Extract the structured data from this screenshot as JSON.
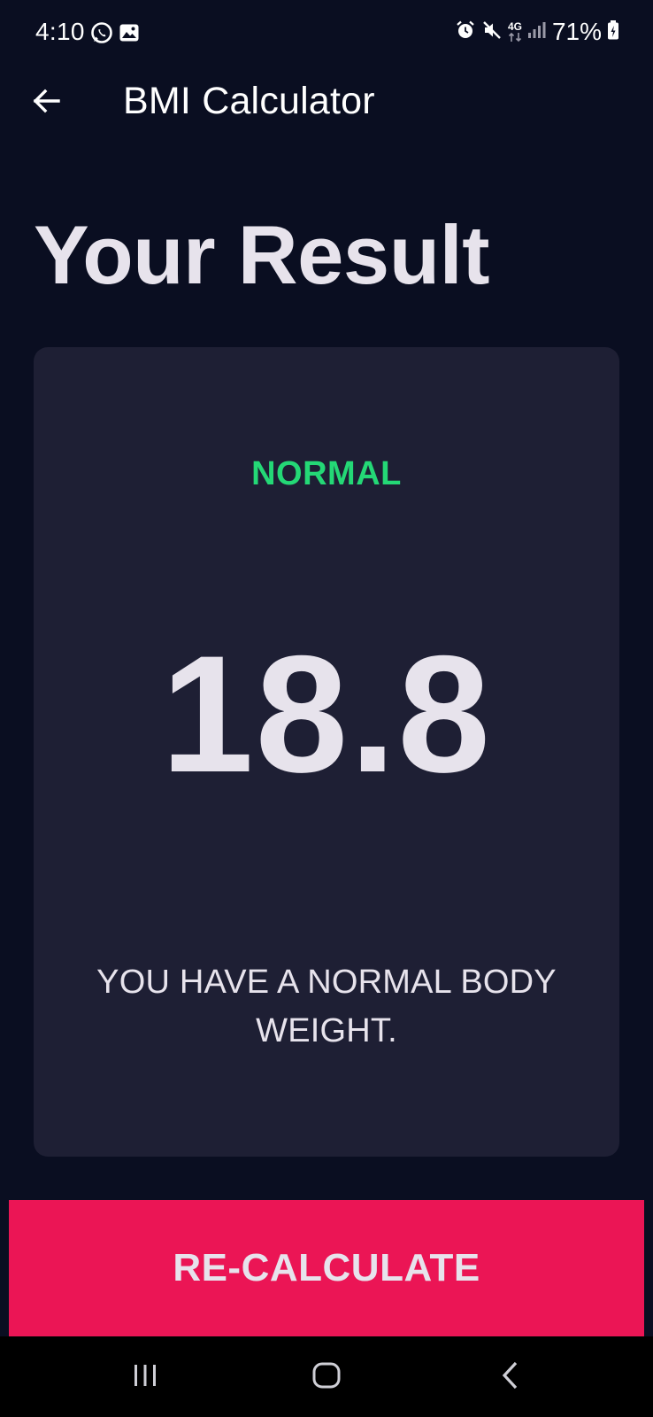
{
  "status_bar": {
    "time": "4:10",
    "left_icons": [
      "whatsapp-icon",
      "image-icon"
    ],
    "right_icons": [
      "alarm-icon",
      "mute-icon",
      "4g-icon",
      "signal-icon",
      "battery-icon"
    ],
    "network_label": "4G",
    "battery_percent": "71%"
  },
  "app_bar": {
    "back_icon": "arrow-left-icon",
    "title": "BMI Calculator"
  },
  "main": {
    "heading": "Your Result",
    "result": {
      "status": "NORMAL",
      "bmi": "18.8",
      "message": "YOU HAVE A NORMAL BODY WEIGHT."
    },
    "recalculate_label": "RE-CALCULATE"
  },
  "nav_bar": {
    "buttons": [
      "recent-apps-icon",
      "home-icon",
      "back-chevron-icon"
    ]
  },
  "colors": {
    "background": "#0a0e21",
    "card": "#1e1f34",
    "status_green": "#24d876",
    "accent_pink": "#eb1555",
    "text": "#e7e3ec"
  }
}
